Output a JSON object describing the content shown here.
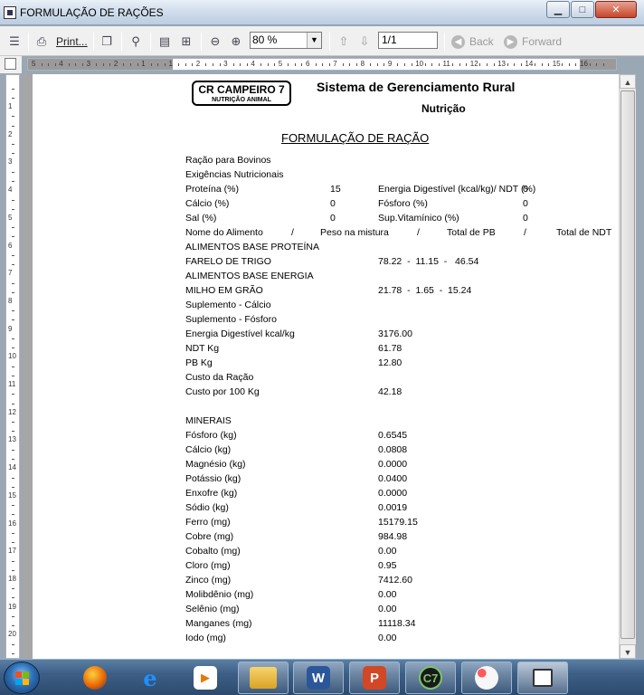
{
  "window": {
    "title": "FORMULAÇÃO DE RAÇÕES"
  },
  "toolbar": {
    "print_label": "Print...",
    "zoom_value": "80 %",
    "page_value": "1/1",
    "back_label": "Back",
    "forward_label": "Forward"
  },
  "report": {
    "logo_line1": "CR CAMPEIRO 7",
    "logo_line2": "NUTRIÇÃO ANIMAL",
    "title": "Sistema de Gerenciamento Rural",
    "subtitle": "Nutrição",
    "heading": "FORMULAÇÃO DE RAÇÃO",
    "racao": "Ração para Bovinos",
    "exigencias": "Exigências Nutricionais",
    "req": {
      "proteina_label": "Proteína (%)",
      "proteina_value": "15",
      "energia_label": "Energia Digestível (kcal/kg)/ NDT (%)",
      "energia_value": "0",
      "calcio_label": "Cálcio (%)",
      "calcio_value": "0",
      "fosforo_label": "Fósforo (%)",
      "fosforo_value": "0",
      "sal_label": "Sal (%)",
      "sal_value": "0",
      "supvit_label": "Sup.Vitamínico (%)",
      "supvit_value": "0"
    },
    "columns": {
      "nome": "Nome do Alimento",
      "sep1": "/",
      "peso": "Peso na mistura",
      "sep2": "/",
      "pb": "Total de PB",
      "sep3": "/",
      "ndt": "Total de NDT"
    },
    "base_proteina": "ALIMENTOS BASE PROTEÍNA",
    "farelo_label": "FARELO DE TRIGO",
    "farelo_values": "78.22  -  11.15  -   46.54",
    "base_energia": "ALIMENTOS BASE ENERGIA",
    "milho_label": "MILHO EM GRÃO",
    "milho_values": "21.78  -  1.65  -  15.24",
    "supl_calcio": "Suplemento - Cálcio",
    "supl_fosforo": "Suplemento - Fósforo",
    "summary": [
      {
        "label": "Energia Digestível kcal/kg",
        "value": "3176.00"
      },
      {
        "label": "NDT Kg",
        "value": "61.78"
      },
      {
        "label": "PB Kg",
        "value": "12.80"
      },
      {
        "label": "Custo da Ração",
        "value": ""
      },
      {
        "label": "Custo por 100 Kg",
        "value": "42.18"
      }
    ],
    "minerais_label": "MINERAIS",
    "minerais": [
      {
        "label": "Fósforo (kg)",
        "value": "0.6545"
      },
      {
        "label": "Cálcio (kg)",
        "value": "0.0808"
      },
      {
        "label": "Magnésio (kg)",
        "value": "0.0000"
      },
      {
        "label": "Potássio (kg)",
        "value": "0.0400"
      },
      {
        "label": "Enxofre (kg)",
        "value": "0.0000"
      },
      {
        "label": "Sódio (kg)",
        "value": "0.0019"
      },
      {
        "label": "Ferro (mg)",
        "value": "15179.15"
      },
      {
        "label": "Cobre (mg)",
        "value": "984.98"
      },
      {
        "label": "Cobalto (mg)",
        "value": "0.00"
      },
      {
        "label": "Cloro (mg)",
        "value": "0.95"
      },
      {
        "label": "Zinco (mg)",
        "value": "7412.60"
      },
      {
        "label": "Molibdênio (mg)",
        "value": "0.00"
      },
      {
        "label": "Selênio (mg)",
        "value": "0.00"
      },
      {
        "label": "Manganes (mg)",
        "value": "11118.34"
      },
      {
        "label": "Iodo (mg)",
        "value": "0.00"
      }
    ]
  },
  "hruler_labels": [
    "5",
    "4",
    "3",
    "2",
    "1",
    "1",
    "2",
    "3",
    "4",
    "5",
    "6",
    "7",
    "8",
    "9",
    "10",
    "11",
    "12",
    "13",
    "14",
    "15",
    "16"
  ],
  "vruler_labels": [
    "1",
    "2",
    "3",
    "4",
    "5",
    "6",
    "7",
    "8",
    "9",
    "10",
    "11",
    "12",
    "13",
    "14",
    "15",
    "16",
    "17",
    "18",
    "19",
    "20",
    "21"
  ],
  "taskbar": {
    "items": [
      "firefox-icon",
      "internet-explorer-icon",
      "media-player-icon",
      "windows-explorer-icon",
      "word-icon",
      "powerpoint-icon",
      "cr-campeiro-icon",
      "paint-icon",
      "report-window-icon"
    ]
  }
}
